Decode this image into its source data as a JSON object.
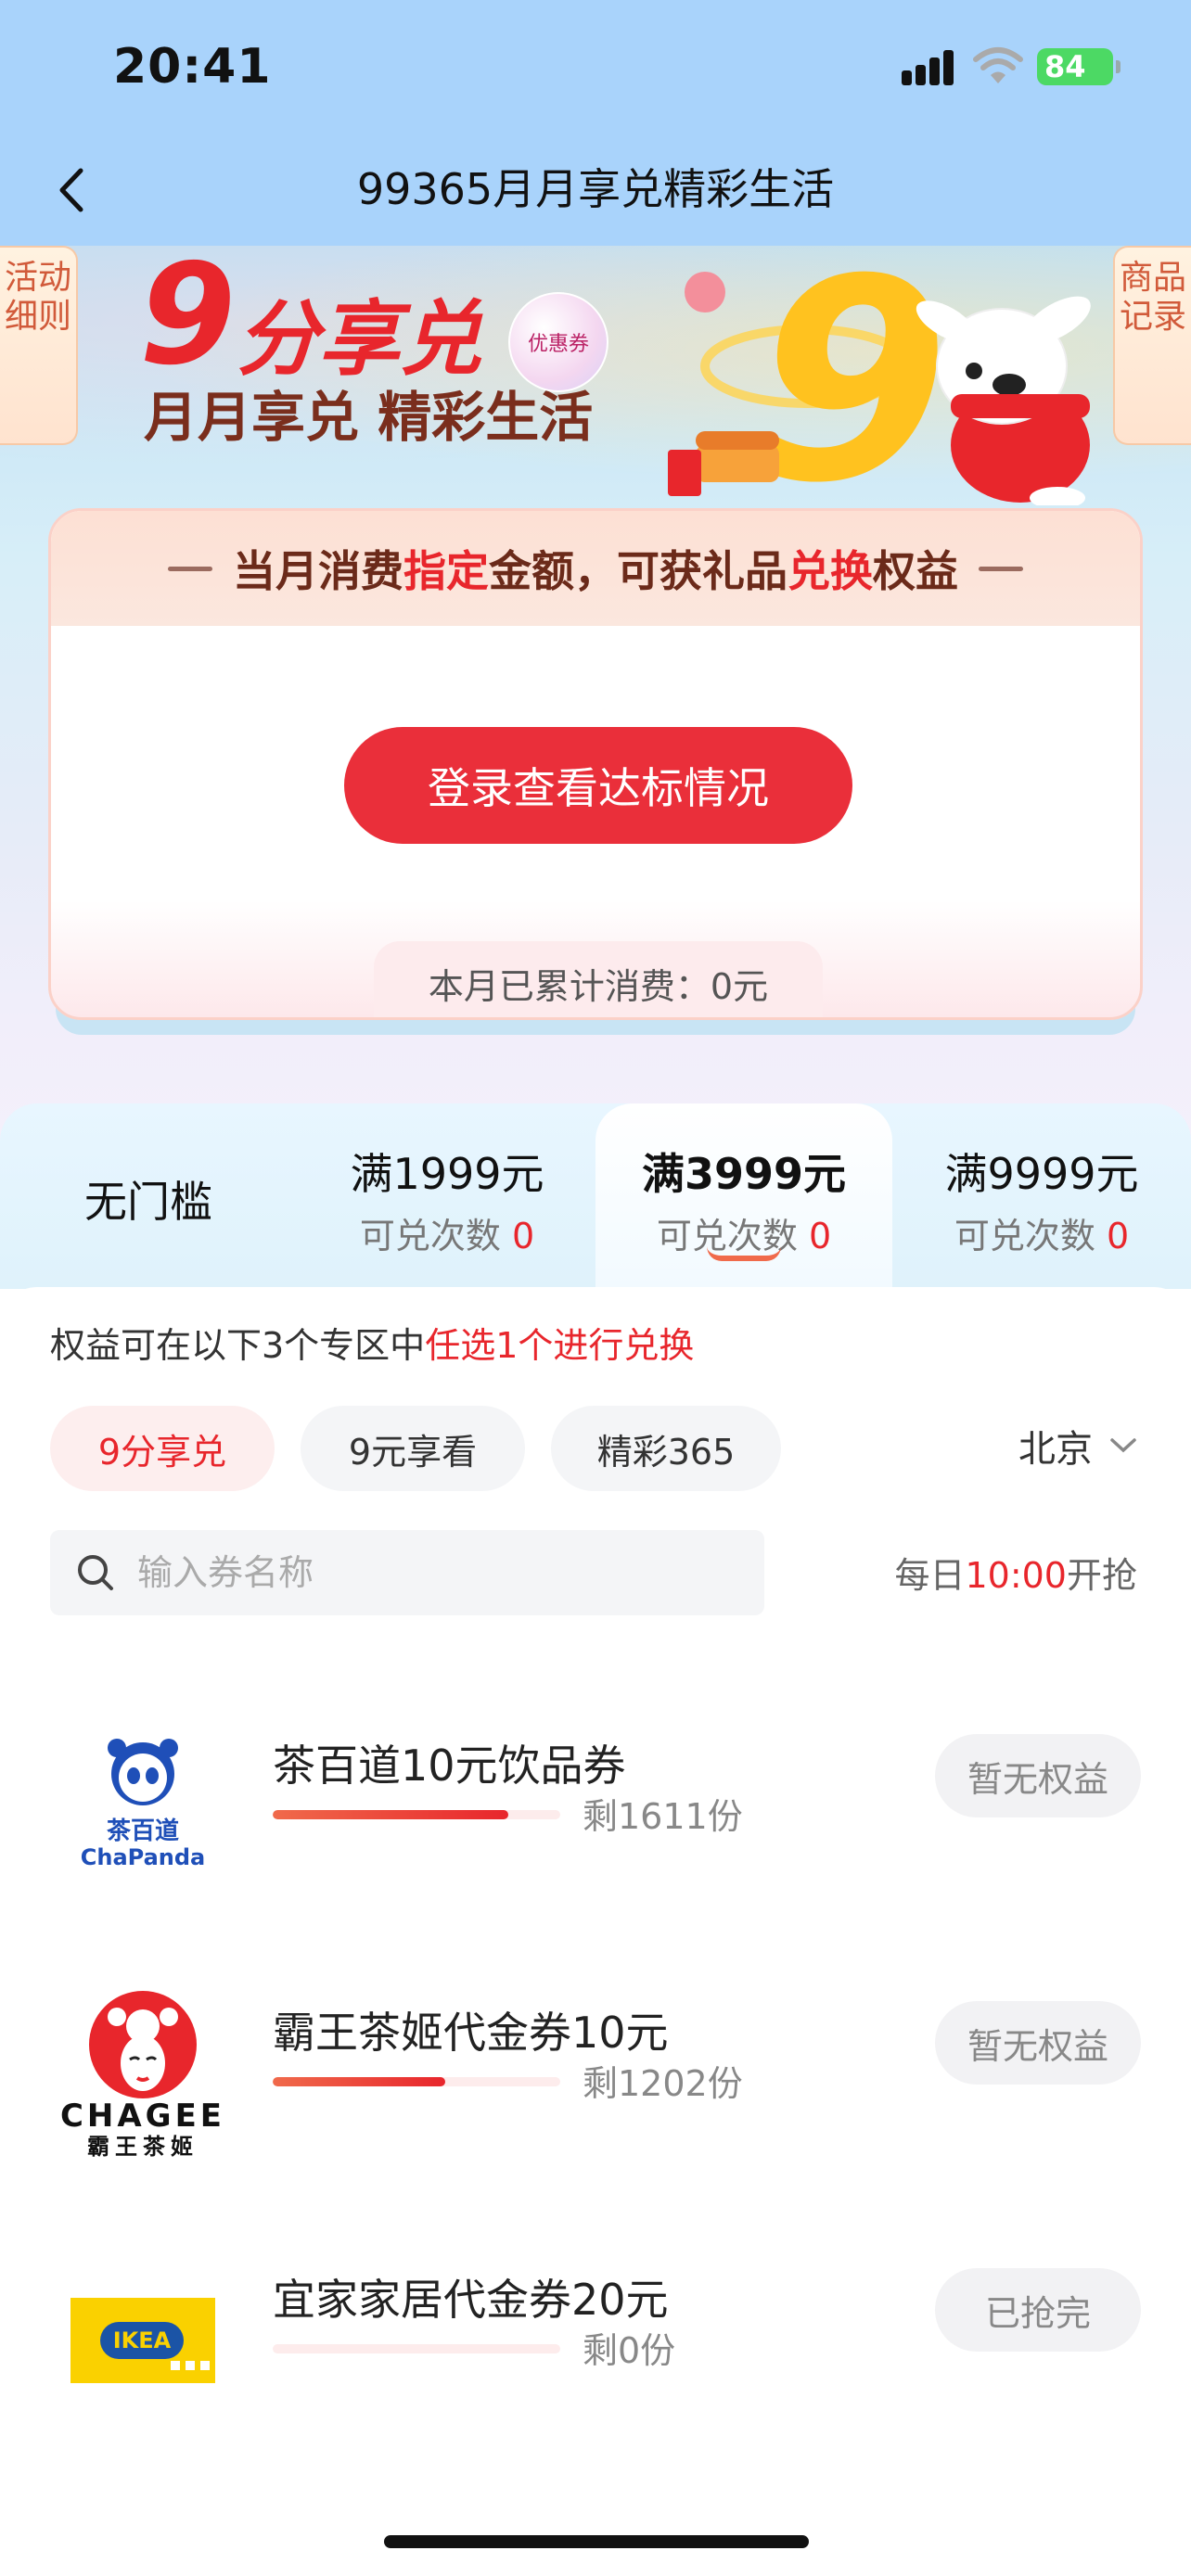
{
  "status_bar": {
    "time": "20:41",
    "battery": "84"
  },
  "nav": {
    "title": "99365月月享兑精彩生活"
  },
  "banner": {
    "left_tab": "活动细则",
    "right_tab": "商品记录",
    "logo_nine": "9",
    "logo_main": "分享兑",
    "logo_sub": "月月享兑 精彩生活",
    "bubble_label": "优惠券"
  },
  "card": {
    "head_parts": [
      "当月消费",
      "指定",
      "金额，可获礼品",
      "兑换",
      "权益"
    ],
    "login_button": "登录查看达标情况",
    "accumulated": "本月已累计消费：0元"
  },
  "tiers": [
    {
      "title": "无门槛",
      "sub_label": "",
      "count": ""
    },
    {
      "title": "满1999元",
      "sub_label": "可兑次数",
      "count": "0"
    },
    {
      "title": "满3999元",
      "sub_label": "可兑次数",
      "count": "0"
    },
    {
      "title": "满9999元",
      "sub_label": "可兑次数",
      "count": "0"
    }
  ],
  "hint": {
    "prefix": "权益可在以下3个专区中",
    "highlight": "任选1个进行兑换"
  },
  "zones": [
    "9分享兑",
    "9元享看",
    "精彩365"
  ],
  "city": "北京",
  "search": {
    "placeholder": "输入券名称"
  },
  "daily": {
    "prefix": "每日",
    "time": "10:00",
    "suffix": "开抢"
  },
  "items": [
    {
      "brand_cn": "茶百道",
      "brand_en": "ChaPanda",
      "name": "茶百道10元饮品券",
      "remaining": "剩1611份",
      "progress": 0.82,
      "status": "暂无权益"
    },
    {
      "brand_cn": "霸王茶姬",
      "brand_en": "CHAGEE",
      "name": "霸王茶姬代金券10元",
      "remaining": "剩1202份",
      "progress": 0.6,
      "status": "暂无权益"
    },
    {
      "brand_cn": "",
      "brand_en": "IKEA",
      "name": "宜家家居代金券20元",
      "remaining": "剩0份",
      "progress": 0.0,
      "status": "已抢完"
    }
  ],
  "colors": {
    "accent_red": "#e8262c",
    "nav_blue": "#a9d3fb",
    "battery_green": "#4cd964"
  }
}
